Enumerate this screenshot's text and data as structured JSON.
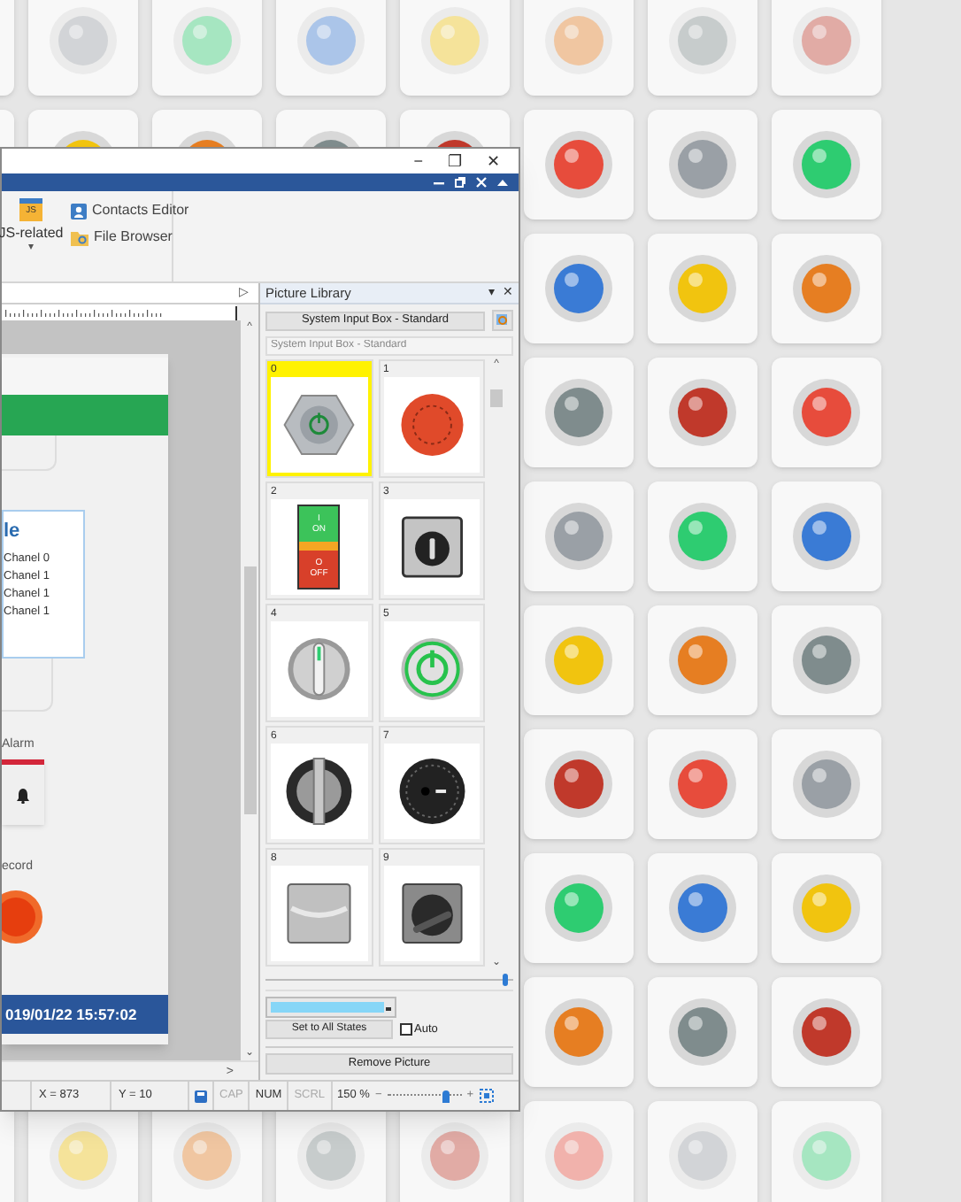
{
  "window": {
    "controls": [
      "−",
      "❐",
      "✕"
    ]
  },
  "ribbon": {
    "js_button": {
      "label": "JS-related",
      "icon_text": "JS",
      "caret": "▾"
    },
    "items": [
      {
        "kind": "contacts",
        "label": "Contacts Editor"
      },
      {
        "kind": "folder",
        "label": "File Browser"
      }
    ]
  },
  "editor": {
    "tab_arrow": "▷",
    "scroll_right": ">",
    "scroll_down": "⌄",
    "scroll_up": "^",
    "page": {
      "card_title": "le",
      "card_lines": [
        "Chanel 0",
        "Chanel 1",
        "Chanel 1",
        "Chanel 1"
      ],
      "alarm_label": "Alarm",
      "record_label": "ecord",
      "footer": "019/01/22 15:57:02"
    }
  },
  "picture_library": {
    "title": "Picture Library",
    "pin": "▾",
    "close": "✕",
    "category": "System Input Box - Standard",
    "name_field": "System Input Box - Standard",
    "scroll_up": "^",
    "scroll_down": "⌄",
    "items": [
      {
        "number": "0",
        "kind": "power-button",
        "selected": true
      },
      {
        "number": "1",
        "kind": "stop-button",
        "selected": false
      },
      {
        "number": "2",
        "kind": "on-off-switch",
        "selected": false,
        "on_text": "ON",
        "off_text": "OFF",
        "on_mark": "I",
        "off_mark": "O"
      },
      {
        "number": "3",
        "kind": "key-switch",
        "selected": false
      },
      {
        "number": "4",
        "kind": "lever-switch",
        "selected": false
      },
      {
        "number": "5",
        "kind": "power-ring",
        "selected": false
      },
      {
        "number": "6",
        "kind": "knob",
        "selected": false
      },
      {
        "number": "7",
        "kind": "dial",
        "selected": false
      },
      {
        "number": "8",
        "kind": "panel",
        "selected": false
      },
      {
        "number": "9",
        "kind": "rotary-switch",
        "selected": false
      }
    ],
    "size_slider": {
      "level": 0.98
    },
    "set_all_button": "Set to All States",
    "auto": {
      "label": "Auto",
      "checked": false
    },
    "remove_button": "Remove Picture"
  },
  "status_bar": {
    "x": "X = 873",
    "y": "Y = 10",
    "indicators": [
      {
        "label": "CAP",
        "on": false
      },
      {
        "label": "NUM",
        "on": true
      },
      {
        "label": "SCRL",
        "on": false
      }
    ],
    "zoom": "150 %",
    "zoom_minus": "−",
    "zoom_plus": "+",
    "zoom_slider": {
      "level": 0.8
    }
  }
}
